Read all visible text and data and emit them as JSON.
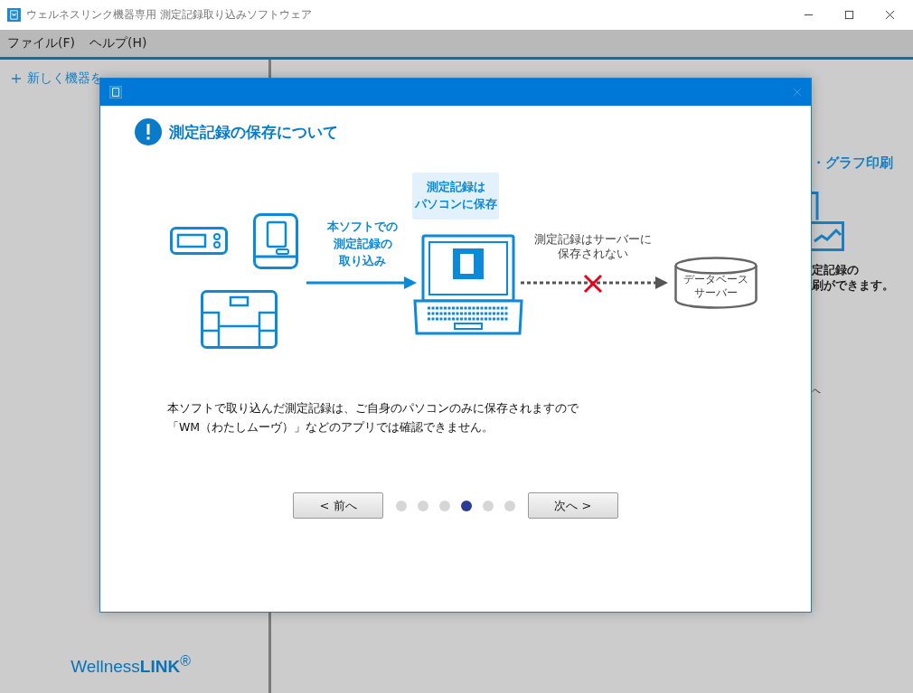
{
  "window": {
    "title": "ウェルネスリンク機器専用 測定記録取り込みソフトウェア"
  },
  "menu": [
    "ファイル(F)",
    "ヘルプ(H)"
  ],
  "sidebar": {
    "add_device": "新しく機器を",
    "logo": "Wellness**LINK**$^{®}$"
  },
  "background_panel": {
    "heading": "・グラフ印刷",
    "lines": [
      "定記録の",
      "刷ができます。"
    ],
    "fragment": "ヘ"
  },
  "dialog": {
    "title": "測定記録の保存について",
    "import_label": [
      "本ソフトでの",
      "測定記録の",
      "取り込み"
    ],
    "bubble": [
      "測定記録は",
      "パソコンに保存"
    ],
    "server_note": [
      "測定記録はサーバーに",
      "保存されない"
    ],
    "server_label": [
      "データベース",
      "サーバー"
    ],
    "message": [
      "本ソフトで取り込んだ測定記録は、ご自身のパソコンのみに保存されますので",
      "「WM（わたしムーヴ）」などのアプリでは確認できません。"
    ],
    "prev": "< 前へ",
    "next": "次へ >",
    "pages": [
      {
        "selected": false
      },
      {
        "selected": false
      },
      {
        "selected": false
      },
      {
        "selected": true
      },
      {
        "selected": false
      },
      {
        "selected": false
      }
    ]
  }
}
